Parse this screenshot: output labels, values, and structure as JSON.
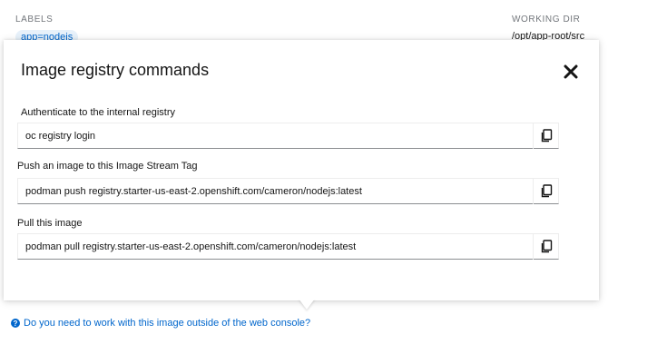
{
  "background": {
    "labels_heading": "LABELS",
    "label_chip": "app=nodejs",
    "working_dir_heading": "WORKING DIR",
    "working_dir_value": "/opt/app-root/src"
  },
  "popover": {
    "title": "Image registry commands",
    "close_icon": "close-icon",
    "sections": [
      {
        "label": "Authenticate to the internal registry",
        "command": "oc registry login",
        "copy_icon": "copy-icon"
      },
      {
        "label": "Push an image to this Image Stream Tag",
        "command": "podman push registry.starter-us-east-2.openshift.com/cameron/nodejs:latest",
        "copy_icon": "copy-icon"
      },
      {
        "label": "Pull this image",
        "command": "podman pull registry.starter-us-east-2.openshift.com/cameron/nodejs:latest",
        "copy_icon": "copy-icon"
      }
    ]
  },
  "help_link": {
    "icon": "question-circle-icon",
    "text": "Do you need to work with this image outside of the web console?"
  },
  "colors": {
    "link": "#0066cc",
    "text": "#151515",
    "muted": "#72767b",
    "chip_bg": "#e7f1fa"
  }
}
